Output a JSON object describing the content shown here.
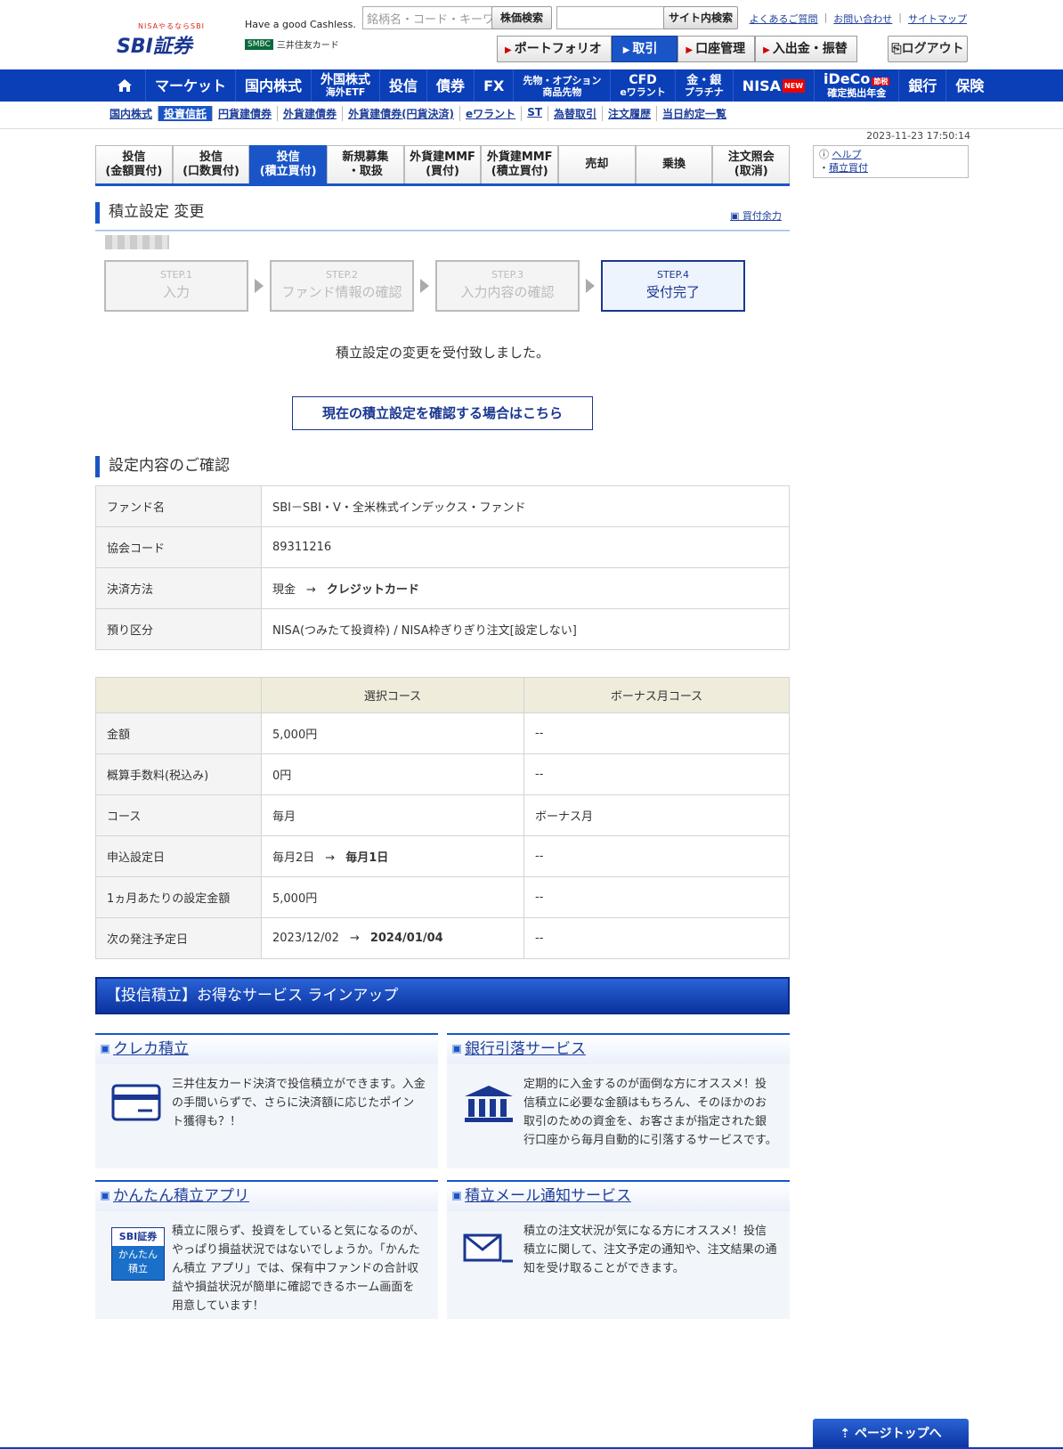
{
  "header": {
    "logo_tagline": "NISAやるならSBI",
    "logo_text": "SBI証券",
    "cashless": "Have a good Cashless.",
    "smbc_mark": "SMBC",
    "smbc_text": "三井住友カード",
    "stock_search_placeholder": "銘柄名・コード・キーワ",
    "stock_search_button": "株価検索",
    "site_search_button": "サイト内検索",
    "links": [
      "よくあるご質問",
      "お問い合わせ",
      "サイトマップ"
    ],
    "main_tabs": [
      {
        "label": "ポートフォリオ",
        "active": false
      },
      {
        "label": "取引",
        "active": true
      },
      {
        "label": "口座管理",
        "active": false
      },
      {
        "label": "入出金・振替",
        "active": false
      }
    ],
    "logout": "ログアウト"
  },
  "global_nav": [
    {
      "label": "マーケット",
      "sub": ""
    },
    {
      "label": "国内株式",
      "sub": ""
    },
    {
      "label": "外国株式",
      "sub": "海外ETF"
    },
    {
      "label": "投信",
      "sub": ""
    },
    {
      "label": "債券",
      "sub": ""
    },
    {
      "label": "FX",
      "sub": ""
    },
    {
      "label": "先物・オプション",
      "sub": "商品先物"
    },
    {
      "label": "CFD",
      "sub": "eワラント"
    },
    {
      "label": "金・銀",
      "sub": "プラチナ"
    },
    {
      "label": "NISA",
      "sub": "",
      "badge": "NEW"
    },
    {
      "label": "iDeCo",
      "sub": "確定拠出年金",
      "badge": "節税"
    },
    {
      "label": "銀行",
      "sub": ""
    },
    {
      "label": "保険",
      "sub": ""
    }
  ],
  "sub_nav": [
    "国内株式",
    "投資信託",
    "円貨建債券",
    "外貨建債券",
    "外貨建債券(円貨決済)",
    "eワラント",
    "ST",
    "為替取引",
    "注文履歴",
    "当日約定一覧"
  ],
  "timestamp": "2023-11-23 17:50:14",
  "sub_tabs": [
    {
      "label": "投信\n(金額買付)",
      "active": false
    },
    {
      "label": "投信\n(口数買付)",
      "active": false
    },
    {
      "label": "投信\n(積立買付)",
      "active": true
    },
    {
      "label": "新規募集\n・取扱",
      "active": false
    },
    {
      "label": "外貨建MMF\n(買付)",
      "active": false
    },
    {
      "label": "外貨建MMF\n(積立買付)",
      "active": false
    },
    {
      "label": "売却",
      "active": false
    },
    {
      "label": "乗換",
      "active": false
    },
    {
      "label": "注文照会\n(取消)",
      "active": false
    }
  ],
  "help": {
    "help": "ヘルプ",
    "tsumitate": "積立買付"
  },
  "page_title": "積立設定 変更",
  "kaizuke_link": "買付余力",
  "steps": [
    {
      "no": "STEP.1",
      "name": "入力",
      "active": false
    },
    {
      "no": "STEP.2",
      "name": "ファンド情報の確認",
      "active": false
    },
    {
      "no": "STEP.3",
      "name": "入力内容の確認",
      "active": false
    },
    {
      "no": "STEP.4",
      "name": "受付完了",
      "active": true
    }
  ],
  "done_message": "積立設定の変更を受付致しました。",
  "confirm_button": "現在の積立設定を確認する場合はこちら",
  "section_title": "設定内容のご確認",
  "fund_table": {
    "fund_name_label": "ファンド名",
    "fund_name": "SBI－SBI・V・全米株式インデックス・ファンド",
    "code_label": "協会コード",
    "code": "89311216",
    "payment_label": "決済方法",
    "payment_from": "現金",
    "payment_to": "クレジットカード",
    "deposit_label": "預り区分",
    "deposit": "NISA(つみたて投資枠) / NISA枠ぎりぎり注文[設定しない]"
  },
  "course_table": {
    "headers": [
      "",
      "選択コース",
      "ボーナス月コース"
    ],
    "amount_label": "金額",
    "amount": "5,000円",
    "amount_bonus": "--",
    "fee_label": "概算手数料(税込み)",
    "fee": "0円",
    "fee_bonus": "--",
    "course_label": "コース",
    "course": "毎月",
    "course_bonus": "ボーナス月",
    "apply_label": "申込設定日",
    "apply_from": "毎月2日",
    "apply_to": "毎月1日",
    "apply_bonus": "--",
    "monthly_label": "1ヵ月あたりの設定金額",
    "monthly": "5,000円",
    "monthly_bonus": "--",
    "next_label": "次の発注予定日",
    "next_from": "2023/12/02",
    "next_to": "2024/01/04",
    "next_bonus": "--",
    "arrow": "→"
  },
  "banner": "【投信積立】お得なサービス ラインアップ",
  "cards": [
    {
      "title": "クレカ積立",
      "text": "三井住友カード決済で投信積立ができます。入金の手間いらずで、さらに決済額に応じたポイント獲得も？！"
    },
    {
      "title": "銀行引落サービス",
      "text": "定期的に入金するのが面倒な方にオススメ！投信積立に必要な金額はもちろん、そのほかのお取引のための資金を、お客さまが指定された銀行口座から毎月自動的に引落するサービスです。"
    },
    {
      "title": "かんたん積立アプリ",
      "text": "積立に限らず、投資をしていると気になるのが、やっぱり損益状況ではないでしょうか。「かんたん積立 アプリ」では、保有中ファンドの合計収益や損益状況が簡単に確認できるホーム画面を用意しています！",
      "app_logo": "SBI証券",
      "app_name": "かんたん積立"
    },
    {
      "title": "積立メール通知サービス",
      "text": "積立の注文状況が気になる方にオススメ！投信積立に関して、注文予定の通知や、注文結果の通知を受け取ることができます。"
    }
  ],
  "page_top": "ページトップへ"
}
